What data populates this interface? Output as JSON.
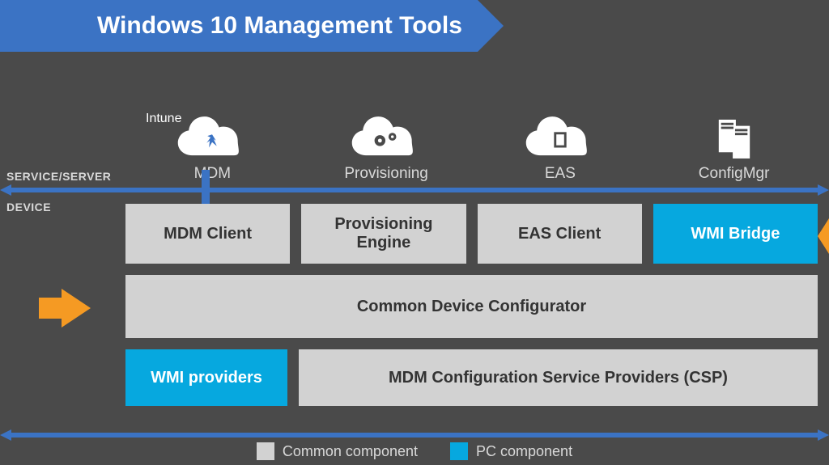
{
  "title": "Windows 10 Management Tools",
  "labels": {
    "service_server": "SERVICE/SERVER",
    "device": "DEVICE"
  },
  "intune_tag": "Intune",
  "services": {
    "mdm": {
      "label": "MDM"
    },
    "provisioning": {
      "label": "Provisioning"
    },
    "eas": {
      "label": "EAS"
    },
    "configmgr": {
      "label": "ConfigMgr"
    }
  },
  "device_boxes": {
    "mdm_client": {
      "label": "MDM Client",
      "type": "common"
    },
    "provisioning_engine": {
      "label": "Provisioning Engine",
      "type": "common"
    },
    "eas_client": {
      "label": "EAS Client",
      "type": "common"
    },
    "wmi_bridge": {
      "label": "WMI Bridge",
      "type": "pc"
    },
    "common_device_cfg": {
      "label": "Common Device Configurator",
      "type": "common"
    },
    "wmi_providers": {
      "label": "WMI providers",
      "type": "pc"
    },
    "mdm_csp": {
      "label": "MDM Configuration Service Providers (CSP)",
      "type": "common"
    }
  },
  "legend": {
    "common": "Common component",
    "pc": "PC component"
  },
  "colors": {
    "banner_blue": "#3b73c4",
    "pc_blue": "#06a8df",
    "common_grey": "#d2d2d2",
    "orange": "#f59a23",
    "bg": "#4a4a4a"
  }
}
